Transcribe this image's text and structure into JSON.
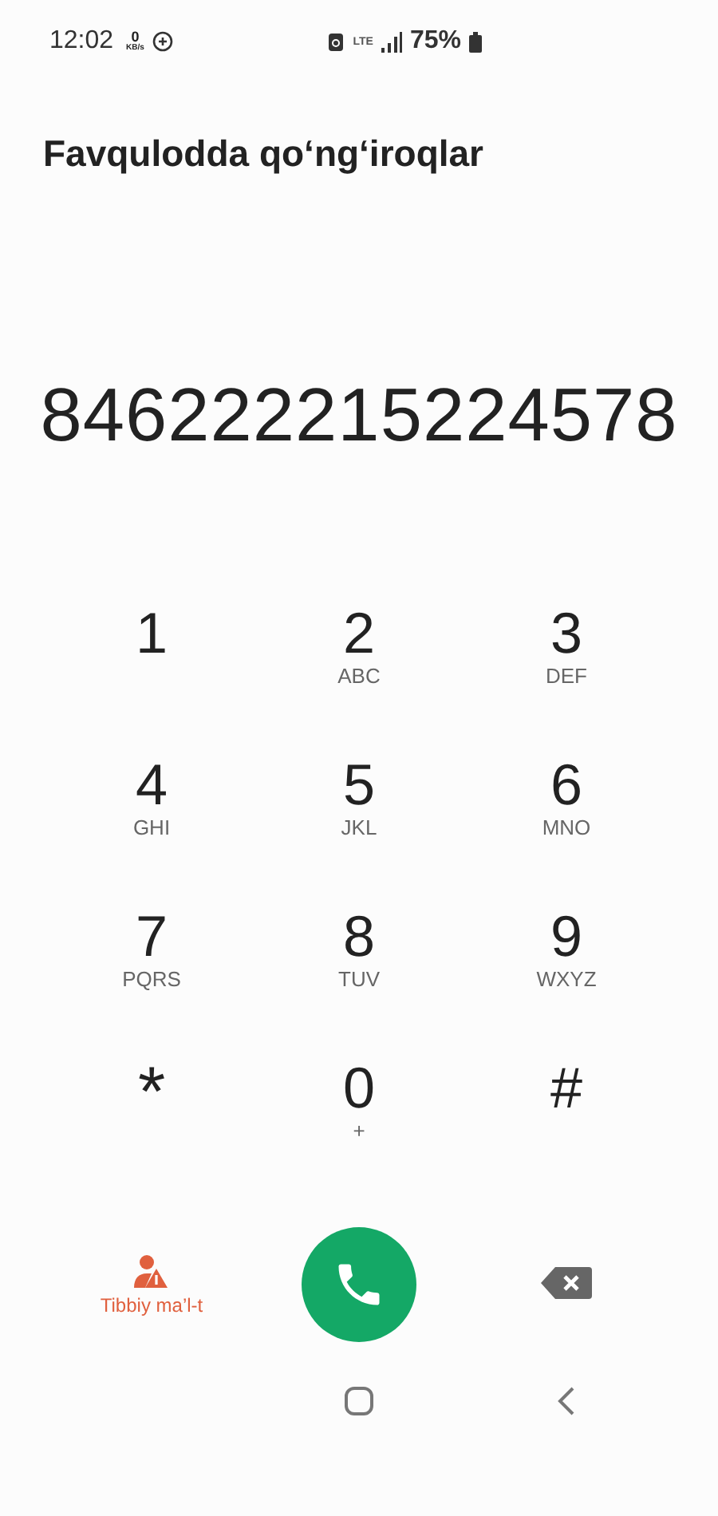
{
  "status_bar": {
    "time": "12:02",
    "speed_value": "0",
    "speed_unit": "KB/s",
    "network": "LTE",
    "battery": "75%"
  },
  "title": "Favqulodda qo‘ng‘iroqlar",
  "number": "846222215224578",
  "keys": [
    {
      "digit": "1"
    },
    {
      "digit": "2",
      "letters": "ABC"
    },
    {
      "digit": "3",
      "letters": "DEF"
    },
    {
      "digit": "4",
      "letters": "GHI"
    },
    {
      "digit": "5",
      "letters": "JKL"
    },
    {
      "digit": "6",
      "letters": "MNO"
    },
    {
      "digit": "7",
      "letters": "PQRS"
    },
    {
      "digit": "8",
      "letters": "TUV"
    },
    {
      "digit": "9",
      "letters": "WXYZ"
    },
    {
      "digit": "*"
    },
    {
      "digit": "0",
      "letters": "+"
    },
    {
      "digit": "#"
    }
  ],
  "medical_info": {
    "label": "Tibbiy ma’l-t"
  }
}
